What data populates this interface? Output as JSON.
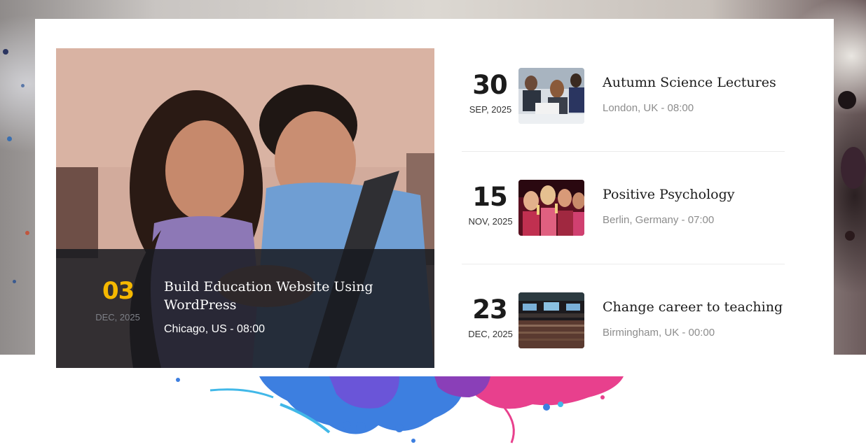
{
  "featured": {
    "day": "03",
    "date": "DEC, 2025",
    "title": "Build Education Website Using WordPress",
    "meta": "Chicago, US - 08:00"
  },
  "events": [
    {
      "day": "30",
      "date": "SEP, 2025",
      "title": "Autumn Science Lectures",
      "meta": "London, UK - 08:00"
    },
    {
      "day": "15",
      "date": "NOV, 2025",
      "title": "Positive Psychology",
      "meta": "Berlin, Germany - 07:00"
    },
    {
      "day": "23",
      "date": "DEC, 2025",
      "title": "Change career to teaching",
      "meta": "Birmingham, UK - 00:00"
    }
  ],
  "colors": {
    "accent": "#f5b800",
    "overlay": "#191b21",
    "title": "#1b1b1b",
    "meta": "#8c8c8c"
  }
}
